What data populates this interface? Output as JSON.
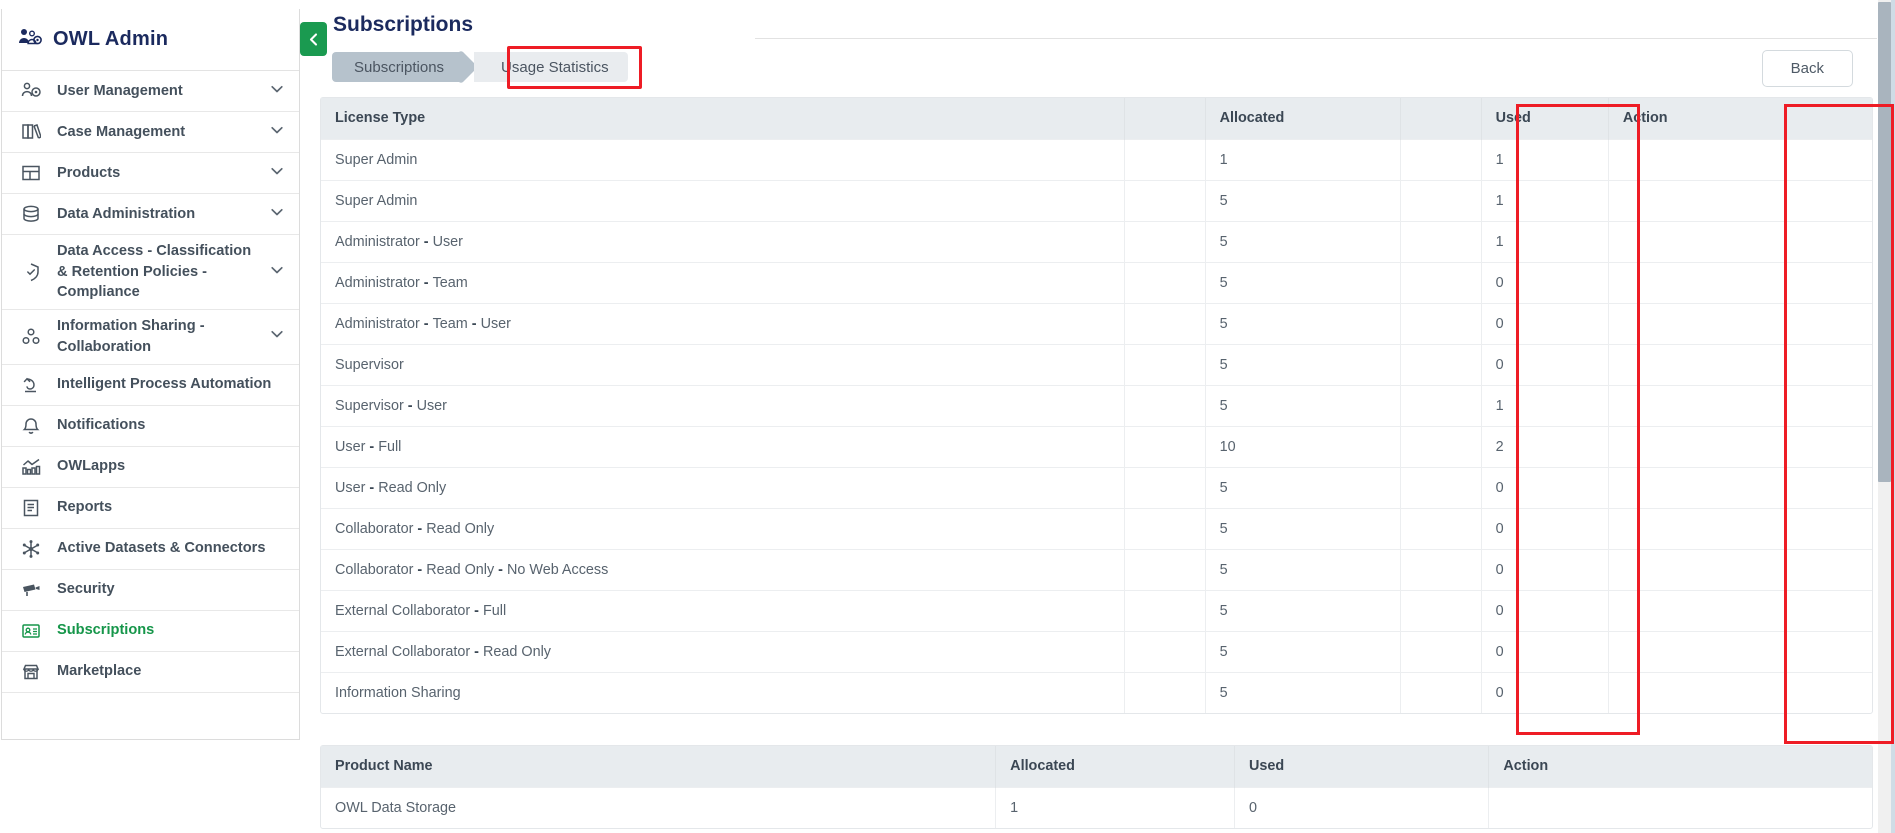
{
  "sidebar": {
    "brand": {
      "label": "OWL Admin",
      "icon": "users-gear-icon"
    },
    "items": [
      {
        "label": "User Management",
        "icon": "users-gear-icon",
        "chevron": true,
        "active": false
      },
      {
        "label": "Case Management",
        "icon": "books-icon",
        "chevron": true,
        "active": false
      },
      {
        "label": "Products",
        "icon": "layout-icon",
        "chevron": true,
        "active": false
      },
      {
        "label": "Data Administration",
        "icon": "database-icon",
        "chevron": true,
        "active": false
      },
      {
        "label": "Data Access - Classification & Retention Policies - Compliance",
        "icon": "shield-check-icon",
        "chevron": true,
        "active": false
      },
      {
        "label": "Information Sharing - Collaboration",
        "icon": "share-nodes-icon",
        "chevron": true,
        "active": false
      },
      {
        "label": "Intelligent Process Automation",
        "icon": "automation-icon",
        "chevron": false,
        "active": false
      },
      {
        "label": "Notifications",
        "icon": "bell-icon",
        "chevron": false,
        "active": false
      },
      {
        "label": "OWLapps",
        "icon": "chart-bars-icon",
        "chevron": false,
        "active": false
      },
      {
        "label": "Reports",
        "icon": "document-lines-icon",
        "chevron": false,
        "active": false
      },
      {
        "label": "Active Datasets & Connectors",
        "icon": "snowflake-icon",
        "chevron": false,
        "active": false
      },
      {
        "label": "Security",
        "icon": "camera-security-icon",
        "chevron": false,
        "active": false
      },
      {
        "label": "Subscriptions",
        "icon": "id-card-icon",
        "chevron": false,
        "active": true
      },
      {
        "label": "Marketplace",
        "icon": "store-icon",
        "chevron": false,
        "active": false
      }
    ]
  },
  "header": {
    "title": "Subscriptions",
    "collapse_icon": "chevron-left-icon",
    "back_label": "Back"
  },
  "tabs": [
    {
      "label": "Subscriptions",
      "selected": true
    },
    {
      "label": "Usage Statistics",
      "selected": false,
      "highlighted": true
    }
  ],
  "license_table": {
    "columns": [
      "License Type",
      "",
      "Allocated",
      "",
      "Used",
      "Action"
    ],
    "rows": [
      {
        "type": "Super Admin",
        "allocated": "1",
        "used": "1",
        "action": ""
      },
      {
        "type": "Super Admin",
        "allocated": "5",
        "used": "1",
        "action": ""
      },
      {
        "type": "Administrator - User",
        "allocated": "5",
        "used": "1",
        "action": ""
      },
      {
        "type": "Administrator - Team",
        "allocated": "5",
        "used": "0",
        "action": ""
      },
      {
        "type": "Administrator - Team - User",
        "allocated": "5",
        "used": "0",
        "action": ""
      },
      {
        "type": "Supervisor",
        "allocated": "5",
        "used": "0",
        "action": ""
      },
      {
        "type": "Supervisor - User",
        "allocated": "5",
        "used": "1",
        "action": ""
      },
      {
        "type": "User - Full",
        "allocated": "10",
        "used": "2",
        "action": ""
      },
      {
        "type": "User - Read Only",
        "allocated": "5",
        "used": "0",
        "action": ""
      },
      {
        "type": "Collaborator - Read Only",
        "allocated": "5",
        "used": "0",
        "action": ""
      },
      {
        "type": "Collaborator - Read Only - No Web Access",
        "allocated": "5",
        "used": "0",
        "action": ""
      },
      {
        "type": "External Collaborator - Full",
        "allocated": "5",
        "used": "0",
        "action": ""
      },
      {
        "type": "External Collaborator - Read Only",
        "allocated": "5",
        "used": "0",
        "action": ""
      },
      {
        "type": "Information Sharing",
        "allocated": "5",
        "used": "0",
        "action": ""
      }
    ]
  },
  "product_table": {
    "columns": [
      "Product Name",
      "Allocated",
      "Used",
      "Action"
    ],
    "rows": [
      {
        "name": "OWL Data Storage",
        "allocated": "1",
        "used": "0",
        "action": ""
      }
    ]
  },
  "colors": {
    "brand_navy": "#1b2a5e",
    "accent_green": "#16964a",
    "highlight_red": "#ee1c25",
    "table_header_bg": "#e8ecef",
    "tab_selected_bg": "#b6c2cc"
  }
}
